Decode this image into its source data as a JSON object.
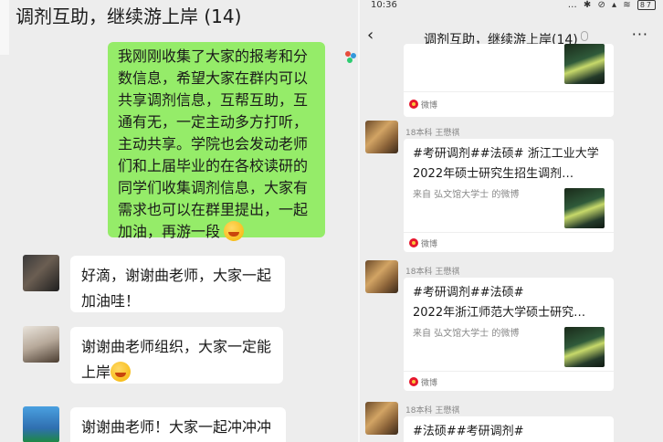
{
  "left_chat": {
    "title": "调剂互助，继续游上岸 (14)",
    "teacher_message": "我刚刚收集了大家的报考和分数信息，希望大家在群内可以共享调剂信息，互帮互助，互通有无，一定主动多方打听，主动共享。学院也会发动老师们和上届毕业的在各校读研的同学们收集调剂信息，大家有需求也可以在群里提出，一起加油，再游一段",
    "replies": [
      {
        "text": "好滴，谢谢曲老师，大家一起加油哇！"
      },
      {
        "text": "谢谢曲老师组织，大家一定能上岸"
      },
      {
        "text": "谢谢曲老师！大家一起冲冲冲呀！"
      }
    ]
  },
  "right_chat": {
    "status_bar": {
      "time": "10:36",
      "icons": "… ✱ ⊘ ▴ ≋",
      "battery": "87"
    },
    "title": "调剂互助，继续游上岸(14)",
    "back_icon": "‹",
    "more_icon": "···",
    "sender": "18本科 王懋祺",
    "cards": [
      {
        "title": "",
        "source": "",
        "footer": "微博"
      },
      {
        "title": "#考研调剂##法硕# 浙江工业大学2022年硕士研究生招生调剂…",
        "source": "来自 弘文馆大学士 的微博",
        "footer": "微博"
      },
      {
        "title": "#考研调剂##法硕#\n2022年浙江师范大学硕士研究…",
        "source": "来自 弘文馆大学士 的微博",
        "footer": "微博"
      },
      {
        "title": "#法硕##考研调剂#",
        "source": "",
        "footer": ""
      }
    ]
  }
}
